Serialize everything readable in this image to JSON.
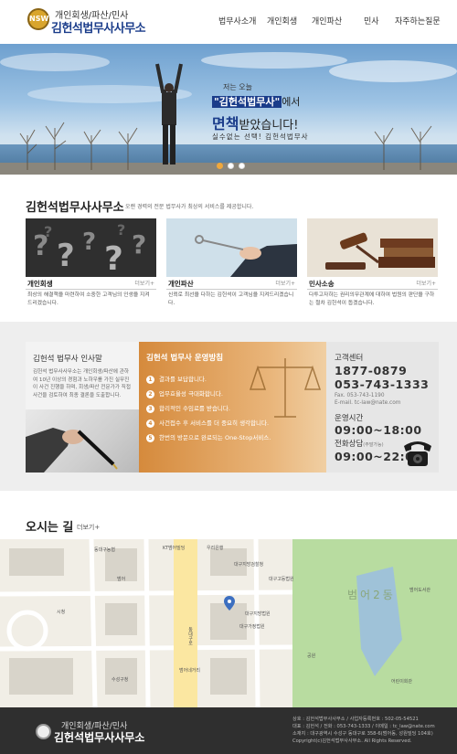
{
  "header": {
    "logo_mark": "NSW",
    "logo_sub": "개인회생/파산/민사",
    "logo_main": "김헌석법무사사무소",
    "nav": [
      "법무사소개",
      "개인회생",
      "개인파산",
      "민사",
      "자주하는질문"
    ]
  },
  "hero": {
    "small": "저는 오늘",
    "line1_highlight": "\"김헌석법무사\"",
    "line1_suffix": "에서",
    "line2_bold": "면책",
    "line2_rest": "받았습니다!",
    "line3": "실수없는 선택! 김헌석법무사"
  },
  "firm": {
    "title": "김헌석법무사사무소",
    "desc": "오랜 경력의 전문 법무사가 최상의 서비스를 제공합니다.",
    "more": "더보기+",
    "cards": [
      {
        "title": "개인회생",
        "desc": "최상의 해결책을 마련하여 소중한 고객님의 인생을 지켜드리겠습니다."
      },
      {
        "title": "개인파산",
        "desc": "신뢰로 최선을 다하는 김헌석이 고객님을 지켜드리겠습니다."
      },
      {
        "title": "민사소송",
        "desc": "다투고자하는 권리의무관계에 대하여 법원의 판단을 구하는 절차 김헌석이 돕겠습니다."
      }
    ]
  },
  "greeting": {
    "title": "김헌석 법무사 인사말",
    "text": "김헌석 법무사사무소는 개인회생/파산에 관하여 10년 이상의 경험과 노하우를 가진 실무진이 사건 진행을 하며, 회생/파산 전문가가 직접 사건을 검토하여 최종 결론을 도출합니다."
  },
  "policy": {
    "title": "김헌석 법무사 운영방침",
    "items": [
      "결과를 보답합니다.",
      "업무효율성 극대화합니다.",
      "합리적인 수임료를 받습니다.",
      "사건접수 후 서비스를 더 중요히 생각합니다.",
      "한번의 방문으로 완료되는 One-Stop서비스."
    ]
  },
  "contact": {
    "title": "고객센터",
    "phone1": "1877-0879",
    "phone2": "053-743-1333",
    "fax": "Fax. 053-743-1190",
    "email": "E-mail. tc-law@nate.com",
    "hours_title": "운영시간",
    "hours": "09:00~18:00",
    "phone_consult_title": "전화상담",
    "phone_consult_note": "(주말가능)",
    "phone_consult_hours": "09:00~22:00"
  },
  "location": {
    "title": "오시는 길",
    "more": "더보기+",
    "map_labels": [
      "동대구농협",
      "KT범어빌딩",
      "우리은행",
      "대구지방검찰청",
      "범어",
      "대구고등법원",
      "대구지방법원",
      "대구가정법원",
      "범어네거리",
      "범어2동",
      "시청",
      "동대구로",
      "수성구청",
      "범어도서관",
      "공원",
      "어린이회관"
    ]
  },
  "footer": {
    "logo_sub": "개인회생/파산/민사",
    "logo_main": "김헌석법무사사무소",
    "info": [
      "상호 : 김헌석법무사사무소 / 사업자등록번호 : 502-05-54521",
      "대표 : 김헌석 / 전화 : 053-743-1333 / 이메일 : tc_law@nate.com",
      "소재지 : 대구광역시 수성구 동대구로 358-6(범어동, 성원빌딩 104호)",
      "Copyright(c)김헌석법무사사무소. All Rights Reserved."
    ]
  },
  "colors": {
    "brand_blue": "#1a3c8a",
    "accent_orange": "#d58a3c",
    "footer_bg": "#2f2f2f",
    "logo_gold": "#d9a52c"
  }
}
